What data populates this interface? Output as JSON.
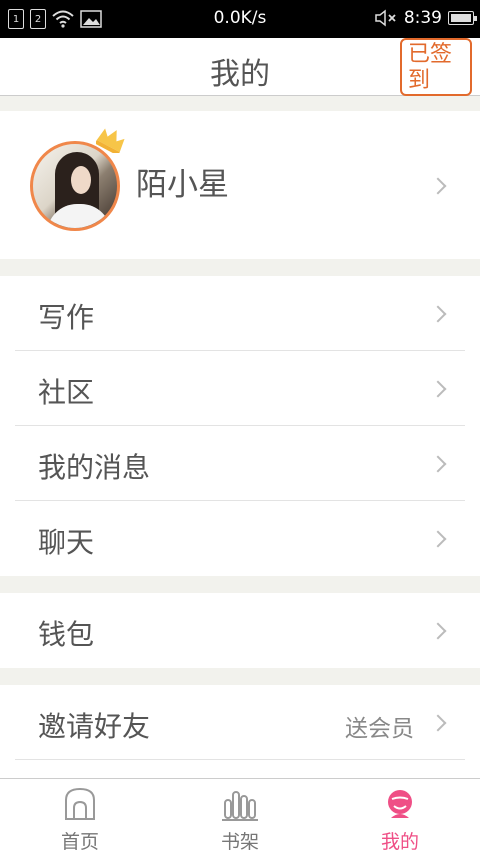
{
  "status_bar": {
    "sim1": "1",
    "sim2": "2",
    "network_speed": "0.0K/s",
    "time": "8:39"
  },
  "header": {
    "title": "我的",
    "checkin_label": "已签到",
    "accent_color": "#e26a2c"
  },
  "profile": {
    "username": "陌小星"
  },
  "menu": {
    "writing": "写作",
    "community": "社区",
    "messages": "我的消息",
    "chat": "聊天",
    "wallet": "钱包",
    "invite": "邀请好友",
    "invite_extra": "送会员"
  },
  "tabbar": {
    "home": "首页",
    "bookshelf": "书架",
    "mine": "我的",
    "active_color": "#ef4f86"
  }
}
